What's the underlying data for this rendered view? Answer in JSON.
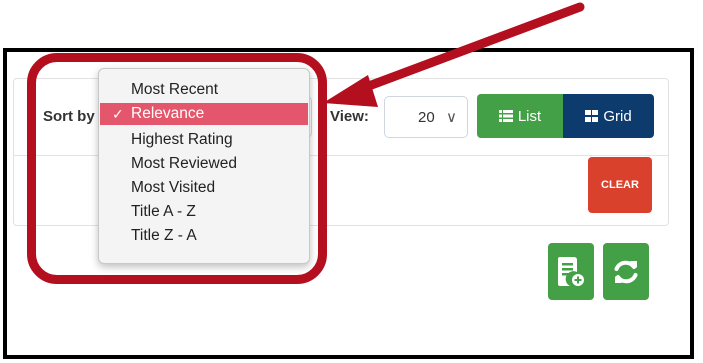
{
  "toolbar": {
    "sort_label": "Sort by",
    "view_label": "View:",
    "view_value": "20",
    "list_label": "List",
    "grid_label": "Grid",
    "clear_label": "CLEAR"
  },
  "sort_dropdown": {
    "selected": "Relevance",
    "options": [
      "Most Recent",
      "Relevance",
      "Highest Rating",
      "Most Reviewed",
      "Most Visited",
      "Title A - Z",
      "Title Z - A"
    ]
  },
  "colors": {
    "green": "#43a047",
    "navy": "#0d3b6e",
    "clear_red": "#d9412c",
    "selected_pink": "#e3566b",
    "annotation_red": "#b30f1f"
  },
  "icons": [
    "list-icon",
    "grid-icon",
    "export-file-icon",
    "refresh-icon",
    "chevron-down-icon",
    "checkmark-icon"
  ]
}
